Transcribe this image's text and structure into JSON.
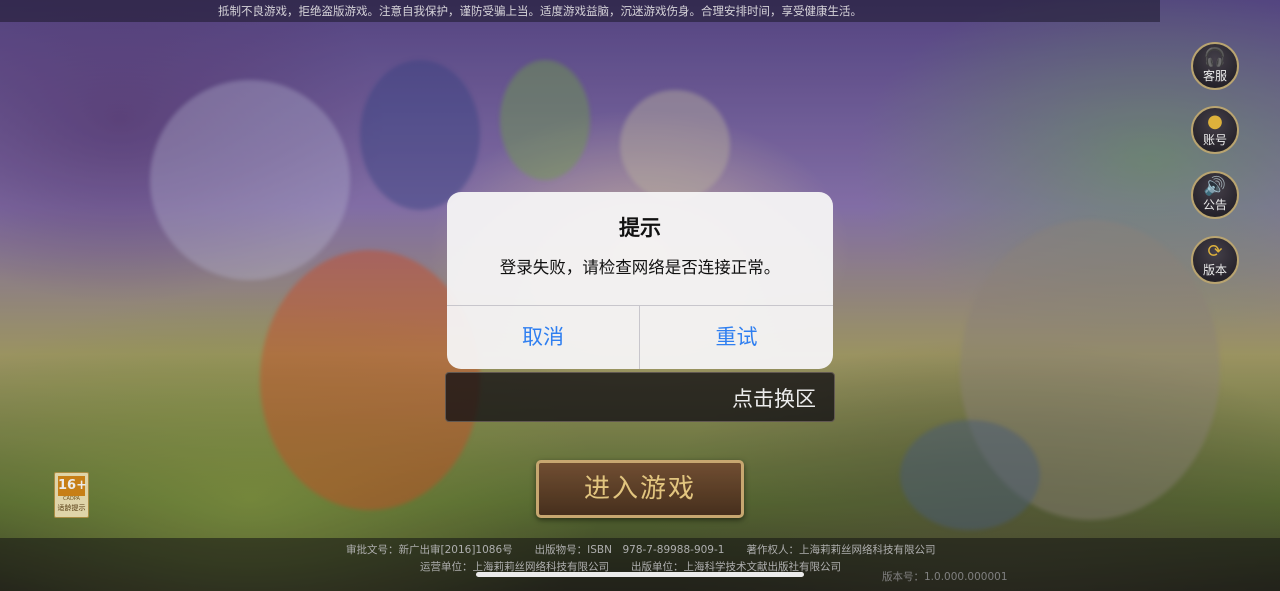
{
  "notice": "抵制不良游戏，拒绝盗版游戏。注意自我保护，谨防受骗上当。适度游戏益脑，沉迷游戏伤身。合理安排时间，享受健康生活。",
  "side_buttons": [
    {
      "label": "客服",
      "icon": "headset-icon",
      "glyph": "🎧"
    },
    {
      "label": "账号",
      "icon": "user-icon",
      "glyph": "●"
    },
    {
      "label": "公告",
      "icon": "speaker-icon",
      "glyph": "🔊"
    },
    {
      "label": "版本",
      "icon": "version-icon",
      "glyph": "⟳"
    }
  ],
  "age_badge": {
    "age": "16+",
    "cadpa": "CADPA",
    "tip": "适龄提示"
  },
  "server": {
    "switch_label": "点击换区"
  },
  "enter_button": "进入游戏",
  "dialog": {
    "title": "提示",
    "message": "登录失败，请检查网络是否连接正常。",
    "cancel": "取消",
    "retry": "重试",
    "button_color": "#2f7ff0"
  },
  "footer": {
    "approval": "审批文号：新广出审[2016]1086号",
    "publication": "出版物号：ISBN　978-7-89988-909-1",
    "copyright": "著作权人：上海莉莉丝网络科技有限公司",
    "operator": "运营单位：上海莉莉丝网络科技有限公司",
    "publisher": "出版单位：上海科学技术文献出版社有限公司",
    "version": "版本号：1.0.000.000001"
  }
}
